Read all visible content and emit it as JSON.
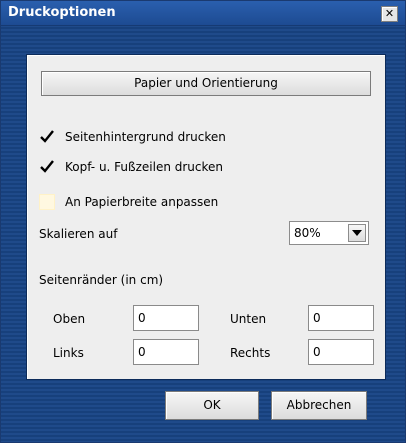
{
  "window": {
    "title": "Druckoptionen",
    "close_symbol": "✕"
  },
  "paper_button": {
    "label": "Papier und Orientierung"
  },
  "options": [
    {
      "label": "Seitenhintergrund drucken",
      "checked": true
    },
    {
      "label": "Kopf- u. Fußzeilen drucken",
      "checked": true
    },
    {
      "label": "An Papierbreite anpassen",
      "checked": false
    }
  ],
  "scale": {
    "label": "Skalieren auf",
    "value": "80%"
  },
  "margins": {
    "title": "Seitenränder (in cm)",
    "top_label": "Oben",
    "top_value": "0",
    "bottom_label": "Unten",
    "bottom_value": "0",
    "left_label": "Links",
    "left_value": "0",
    "right_label": "Rechts",
    "right_value": "0"
  },
  "buttons": {
    "ok": "OK",
    "cancel": "Abbrechen"
  }
}
